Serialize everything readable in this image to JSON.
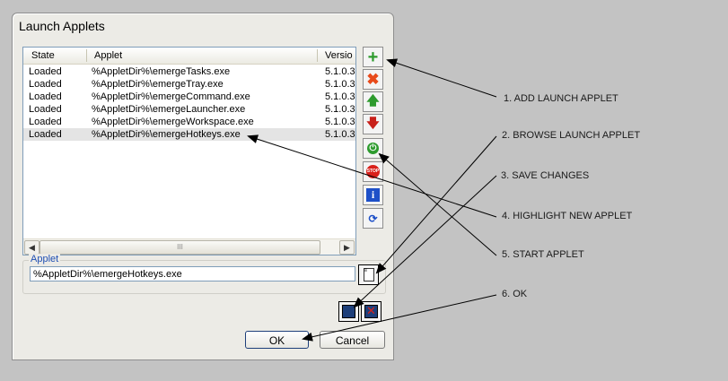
{
  "window": {
    "title": "Launch Applets"
  },
  "listview": {
    "columns": [
      "State",
      "Applet",
      "Versio"
    ],
    "rows": [
      {
        "state": "Loaded",
        "applet": "%AppletDir%\\emergeTasks.exe",
        "version": "5.1.0.3"
      },
      {
        "state": "Loaded",
        "applet": "%AppletDir%\\emergeTray.exe",
        "version": "5.1.0.3"
      },
      {
        "state": "Loaded",
        "applet": "%AppletDir%\\emergeCommand.exe",
        "version": "5.1.0.3"
      },
      {
        "state": "Loaded",
        "applet": "%AppletDir%\\emergeLauncher.exe",
        "version": "5.1.0.3"
      },
      {
        "state": "Loaded",
        "applet": "%AppletDir%\\emergeWorkspace.exe",
        "version": "5.1.0.3"
      },
      {
        "state": "Loaded",
        "applet": "%AppletDir%\\emergeHotkeys.exe",
        "version": "5.1.0.3"
      }
    ],
    "scroll_thumb_glyph": "III"
  },
  "toolbar": {
    "icons": [
      "add-icon",
      "delete-icon",
      "move-up-icon",
      "move-down-icon",
      "start-icon",
      "stop-icon",
      "info-icon",
      "gather-icon"
    ],
    "stop_text": "STOP"
  },
  "applet_group": {
    "label": "Applet",
    "value": "%AppletDir%\\emergeHotkeys.exe"
  },
  "buttons": {
    "ok": "OK",
    "cancel": "Cancel"
  },
  "annotations": [
    "1.  ADD LAUNCH APPLET",
    "2.  BROWSE LAUNCH APPLET",
    "3.  SAVE CHANGES",
    "4.  HIGHLIGHT NEW APPLET",
    "5.  START APPLET",
    "6.  OK"
  ],
  "colors": {
    "background": "#c3c3c3",
    "dialog": "#ecebe6",
    "group_label": "#1f4fb3",
    "add_green": "#2e9b2e",
    "delete_red": "#e84a1a",
    "info_blue": "#1e50c8"
  }
}
